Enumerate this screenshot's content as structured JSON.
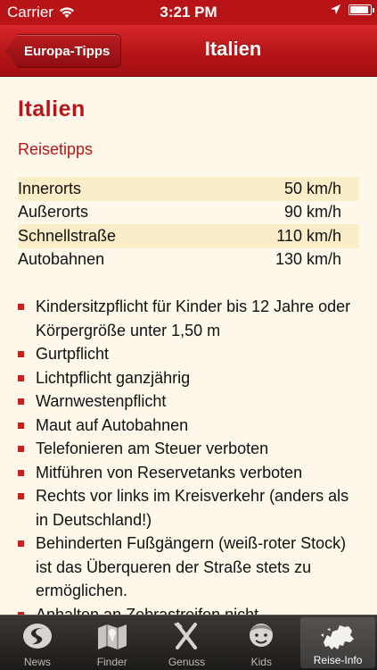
{
  "status_bar": {
    "carrier": "Carrier",
    "time": "3:21 PM",
    "battery_level": 0.9
  },
  "nav": {
    "back_label": "Europa-Tipps",
    "title": "Italien"
  },
  "content": {
    "heading": "Italien",
    "section_title": "Reisetipps",
    "speed_limits": [
      {
        "label": "Innerorts",
        "value": "50 km/h"
      },
      {
        "label": "Außerorts",
        "value": "90 km/h"
      },
      {
        "label": "Schnellstraße",
        "value": "110 km/h"
      },
      {
        "label": "Autobahnen",
        "value": "130 km/h"
      }
    ],
    "rules": [
      "Kindersitzpflicht für Kinder bis 12 Jahre oder Körpergröße unter 1,50 m",
      "Gurtpflicht",
      "Lichtpflicht ganzjährig",
      "Warnwestenpflicht",
      "Maut auf Autobahnen",
      "Telefonieren am Steuer verboten",
      "Mitführen von Reservetanks verboten",
      "Rechts vor links im Kreisverkehr (anders als in Deutschland!)",
      "Behinderten Fußgängern (weiß-roter Stock) ist das Überqueren der Straße stets zu ermöglichen.",
      "Anhalten an Zebrastreifen nicht"
    ]
  },
  "tabs": [
    {
      "label": "News",
      "icon": "news-icon"
    },
    {
      "label": "Finder",
      "icon": "map-icon"
    },
    {
      "label": "Genuss",
      "icon": "cutlery-icon"
    },
    {
      "label": "Kids",
      "icon": "kid-face-icon"
    },
    {
      "label": "Reise-Info",
      "icon": "europe-map-icon",
      "active": true
    }
  ],
  "colors": {
    "brand_red": "#b5161a",
    "background": "#fdf8ea",
    "row_highlight": "#faedc7"
  }
}
